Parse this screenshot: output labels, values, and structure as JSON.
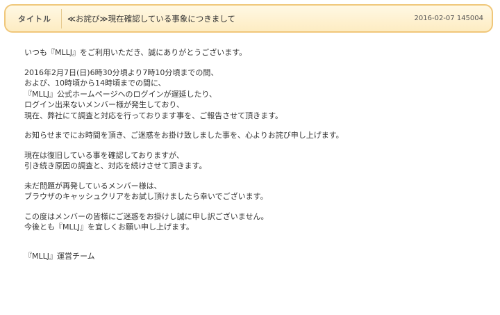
{
  "header": {
    "label": "タイトル",
    "title": "≪お詫び≫現在確認している事象につきまして",
    "date": "2016-02-07 145004"
  },
  "body": {
    "paragraphs": [
      [
        "いつも『MLLJ』をご利用いただき、誠にありがとうございます。"
      ],
      [
        "2016年2月7日(日)6時30分頃より7時10分頃までの間、",
        "および、10時頃から14時頃までの間に、",
        "『MLLJ』公式ホームページへのログインが遅延したり、",
        "ログイン出来ないメンバー様が発生しており、",
        "現在、弊社にて調査と対応を行っております事を、ご報告させて頂きます。"
      ],
      [
        "お知らせまでにお時間を頂き、ご迷惑をお掛け致しました事を、心よりお詫び申し上げます。"
      ],
      [
        "現在は復旧している事を確認しておりますが、",
        "引き続き原因の調査と、対応を続けさせて頂きます。"
      ],
      [
        "未だ問題が再発しているメンバー様は、",
        "ブラウザのキャッシュクリアをお試し頂けましたら幸いでございます。"
      ],
      [
        "この度はメンバーの皆様にご迷惑をお掛けし誠に申し訳ございません。",
        "今後とも『MLLJ』を宜しくお願い申し上げます。"
      ]
    ],
    "signature": "『MLLJ』運営チーム"
  }
}
